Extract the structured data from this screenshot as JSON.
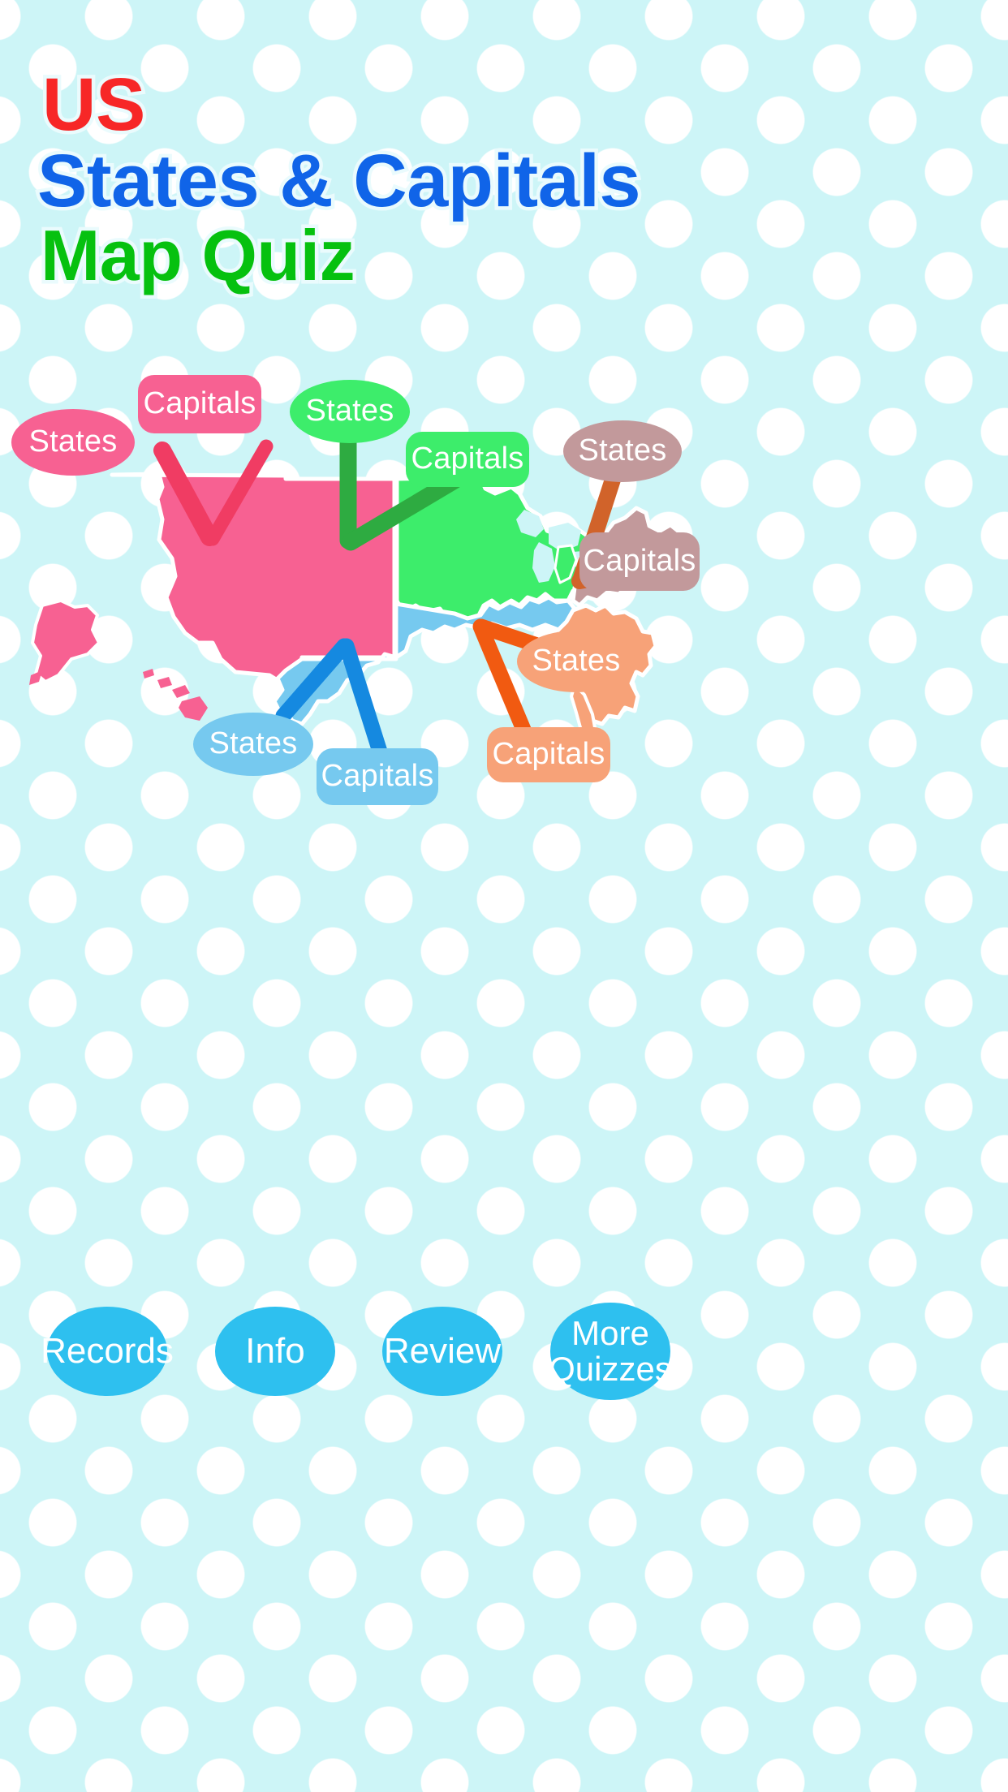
{
  "app": {
    "title_lines": [
      {
        "text": "US",
        "color": "#f72727"
      },
      {
        "text": "States & Capitals",
        "color": "#1064e8"
      },
      {
        "text": "Map Quiz",
        "color": "#06c10f"
      }
    ]
  },
  "theme": {
    "background": "#cdf5f7",
    "dot_color": "#ffffff",
    "button_color": "#2ec0ef",
    "button_text_color": "#ffffff"
  },
  "map": {
    "regions": [
      {
        "name": "west",
        "fill": "#f76192",
        "accent": "#f03c63"
      },
      {
        "name": "midwest",
        "fill": "#3ded6b",
        "accent": "#2eab41"
      },
      {
        "name": "northeast",
        "fill": "#c2999b",
        "accent": "#d1632a"
      },
      {
        "name": "south",
        "fill": "#76c9ef",
        "accent": "#1589e0"
      },
      {
        "name": "southeast",
        "fill": "#f7a278",
        "accent": "#f15a11"
      }
    ],
    "border_color": "#ffffff"
  },
  "callouts": [
    {
      "id": "west-states",
      "label": "States",
      "region": "west",
      "shape": "oval",
      "fill": "#f76192"
    },
    {
      "id": "west-capitals",
      "label": "Capitals",
      "region": "west",
      "shape": "box",
      "fill": "#f76192"
    },
    {
      "id": "midwest-states",
      "label": "States",
      "region": "midwest",
      "shape": "oval",
      "fill": "#3ded6b"
    },
    {
      "id": "midwest-capitals",
      "label": "Capitals",
      "region": "midwest",
      "shape": "box",
      "fill": "#3ded6b"
    },
    {
      "id": "northeast-states",
      "label": "States",
      "region": "northeast",
      "shape": "oval",
      "fill": "#c2999b"
    },
    {
      "id": "northeast-capitals",
      "label": "Capitals",
      "region": "northeast",
      "shape": "box",
      "fill": "#c2999b"
    },
    {
      "id": "south-states",
      "label": "States",
      "region": "south",
      "shape": "oval",
      "fill": "#76c9ef"
    },
    {
      "id": "south-capitals",
      "label": "Capitals",
      "region": "south",
      "shape": "box",
      "fill": "#76c9ef"
    },
    {
      "id": "southeast-states",
      "label": "States",
      "region": "southeast",
      "shape": "oval",
      "fill": "#f7a278"
    },
    {
      "id": "southeast-capitals",
      "label": "Capitals",
      "region": "southeast",
      "shape": "box",
      "fill": "#f7a278"
    }
  ],
  "buttons": [
    {
      "id": "records",
      "label": "Records"
    },
    {
      "id": "info",
      "label": "Info"
    },
    {
      "id": "review",
      "label": "Review"
    },
    {
      "id": "more-quizzes",
      "label": "More\nQuizzes"
    }
  ]
}
